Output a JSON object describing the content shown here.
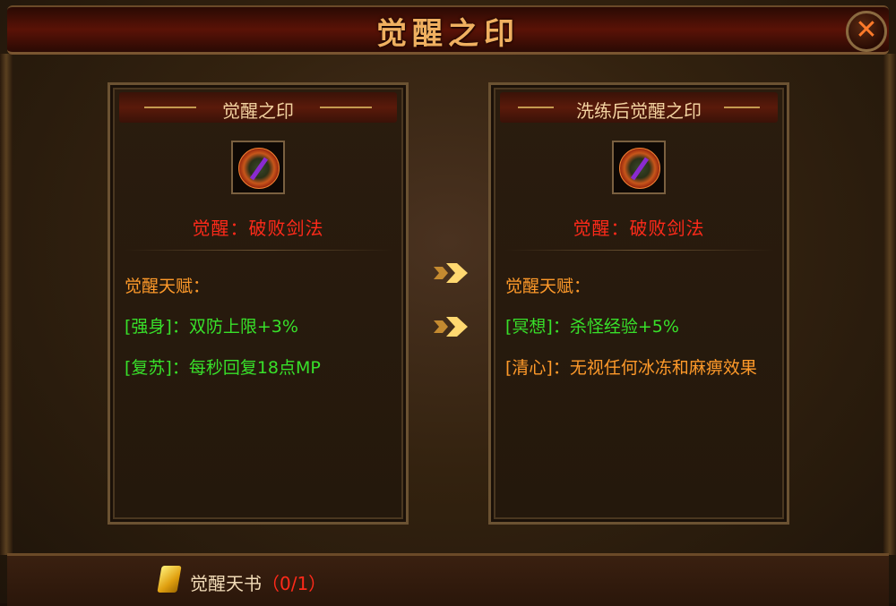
{
  "window": {
    "title": "觉醒之印",
    "close_label": "✕"
  },
  "left_panel": {
    "header": "觉醒之印",
    "icon": "awakening-seal-icon",
    "awakening_name": "觉醒：破败剑法",
    "talent_heading": "觉醒天赋：",
    "talents": [
      {
        "text": "[强身]：双防上限+3%",
        "color": "#38e02a"
      },
      {
        "text": "[复苏]：每秒回复18点MP",
        "color": "#38e02a"
      }
    ]
  },
  "right_panel": {
    "header": "洗练后觉醒之印",
    "icon": "awakening-seal-icon",
    "awakening_name": "觉醒：破败剑法",
    "talent_heading": "觉醒天赋：",
    "talents": [
      {
        "text": "[冥想]：杀怪经验+5%",
        "color": "#38e02a"
      },
      {
        "text": "[清心]：无视任何冰冻和麻痹效果",
        "color": "#ff9a2a"
      }
    ]
  },
  "footer": {
    "item_icon": "book-scroll-icon",
    "item_label": "觉醒天书",
    "item_count": "（0/1）"
  }
}
